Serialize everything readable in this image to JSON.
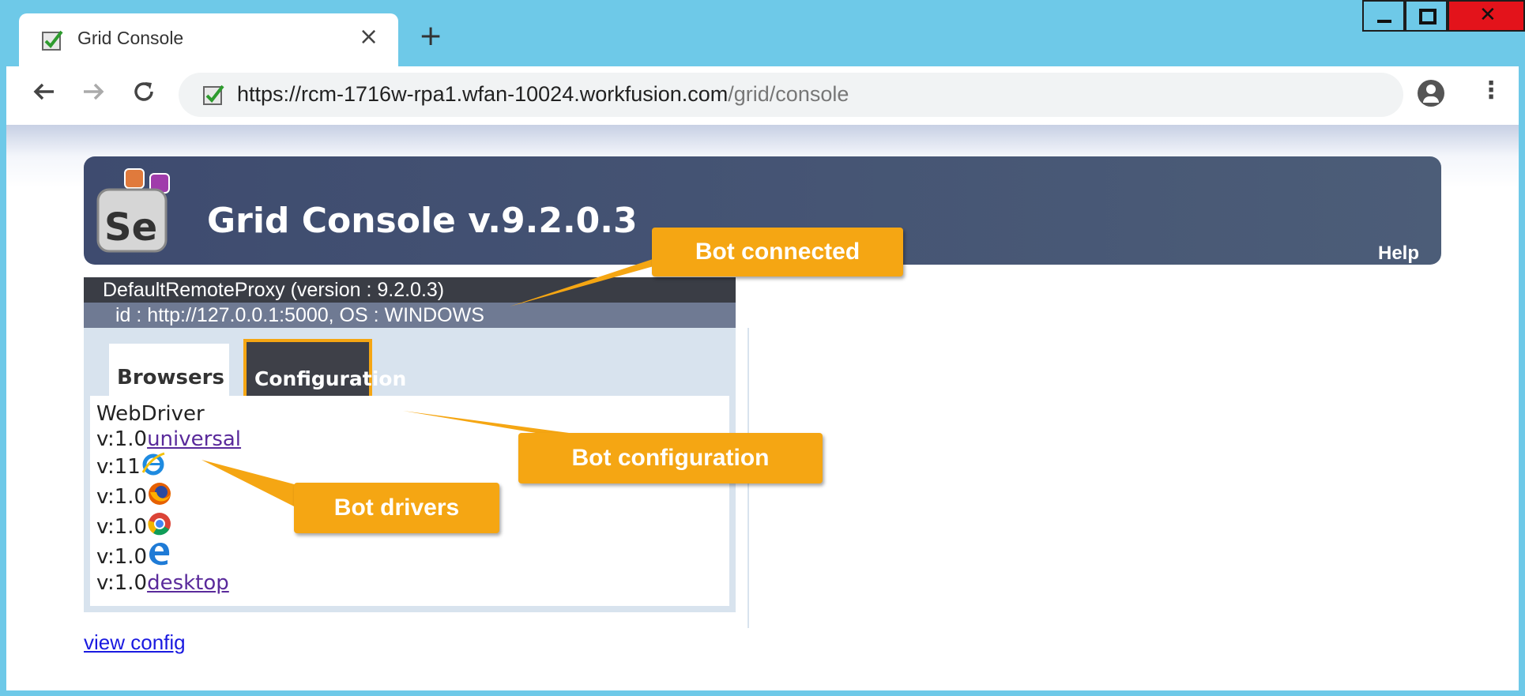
{
  "browser": {
    "tab_title": "Grid Console",
    "tab_close": "×",
    "new_tab": "+",
    "url_host": "https://rcm-1716w-rpa1.wfan-10024.workfusion.com",
    "url_path": "/grid/console",
    "icons": [
      "favicon-check-icon",
      "back-arrow-icon",
      "forward-arrow-icon",
      "reload-icon",
      "profile-icon",
      "menu-dots-icon",
      "minimize-icon",
      "maximize-icon",
      "close-icon"
    ]
  },
  "banner": {
    "title": "Grid Console v.9.2.0.3",
    "help": "Help",
    "logo_text": "Se"
  },
  "proxy": {
    "name": "DefaultRemoteProxy (version : 9.2.0.3)",
    "id": "id : http://127.0.0.1:5000, OS : WINDOWS",
    "tabs": [
      "Browsers",
      "Configuration"
    ],
    "webdriver_label": "WebDriver",
    "rows": [
      {
        "version": "v:1.0",
        "link": "universal",
        "icon": ""
      },
      {
        "version": "v:11",
        "link": "",
        "icon": "internet-explorer-icon"
      },
      {
        "version": "v:1.0",
        "link": "",
        "icon": "firefox-icon"
      },
      {
        "version": "v:1.0",
        "link": "",
        "icon": "chrome-icon"
      },
      {
        "version": "v:1.0",
        "link": "",
        "icon": "edge-icon"
      },
      {
        "version": "v:1.0",
        "link": "desktop",
        "icon": ""
      }
    ]
  },
  "view_config": "view config",
  "callouts": {
    "connected": "Bot connected",
    "configuration": "Bot configuration",
    "drivers": "Bot drivers"
  },
  "colors": {
    "accent": "#f5a613",
    "chrome_bar": "#6ec9e8",
    "banner": "#3e4b6f"
  }
}
